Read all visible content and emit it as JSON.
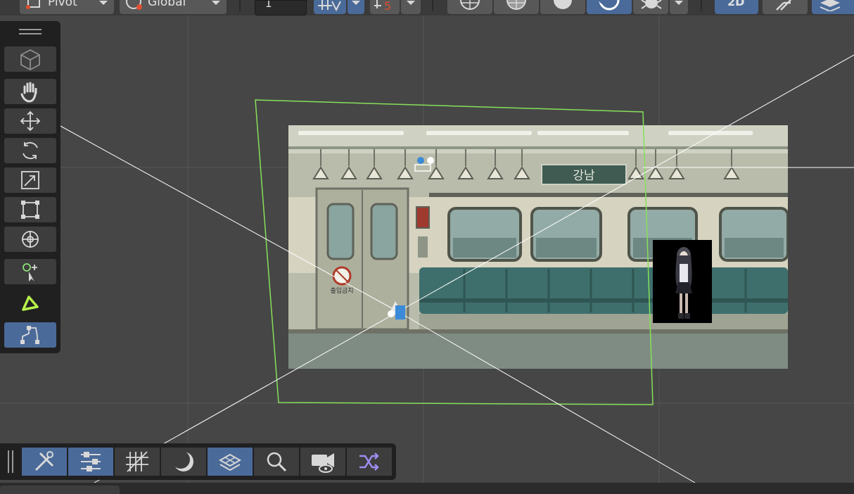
{
  "toolbar": {
    "pivot_label": "Pivot",
    "global_label": "Global",
    "snap_value": "1",
    "mode_2d_label": "2D"
  },
  "scene": {
    "station_sign": "강남",
    "door_sign": "출입금지"
  },
  "tools": [
    {
      "name": "view-cube-icon"
    },
    {
      "name": "hand-tool-icon"
    },
    {
      "name": "move-tool-icon"
    },
    {
      "name": "rotate-tool-icon"
    },
    {
      "name": "scale-tool-icon"
    },
    {
      "name": "rect-tool-icon"
    },
    {
      "name": "transform-tool-icon"
    },
    {
      "name": "custom-tool-icon"
    },
    {
      "name": "triangle-tool-icon"
    },
    {
      "name": "path-tool-icon"
    }
  ],
  "overlays": [
    {
      "name": "tools-overlay-icon",
      "active": true
    },
    {
      "name": "settings-overlay-icon",
      "active": true
    },
    {
      "name": "grid-overlay-icon",
      "active": false
    },
    {
      "name": "shading-overlay-icon",
      "active": false
    },
    {
      "name": "layers-overlay-icon",
      "active": true
    },
    {
      "name": "search-overlay-icon",
      "active": false
    },
    {
      "name": "camera-overlay-icon",
      "active": false
    },
    {
      "name": "shuffle-overlay-icon",
      "active": false
    }
  ],
  "colors": {
    "viewport_bg": "#464646",
    "panel_bg": "#202020",
    "active_blue": "#4a6a99",
    "frustum_green": "#86e05a",
    "accent_lime": "#b6f04a"
  }
}
